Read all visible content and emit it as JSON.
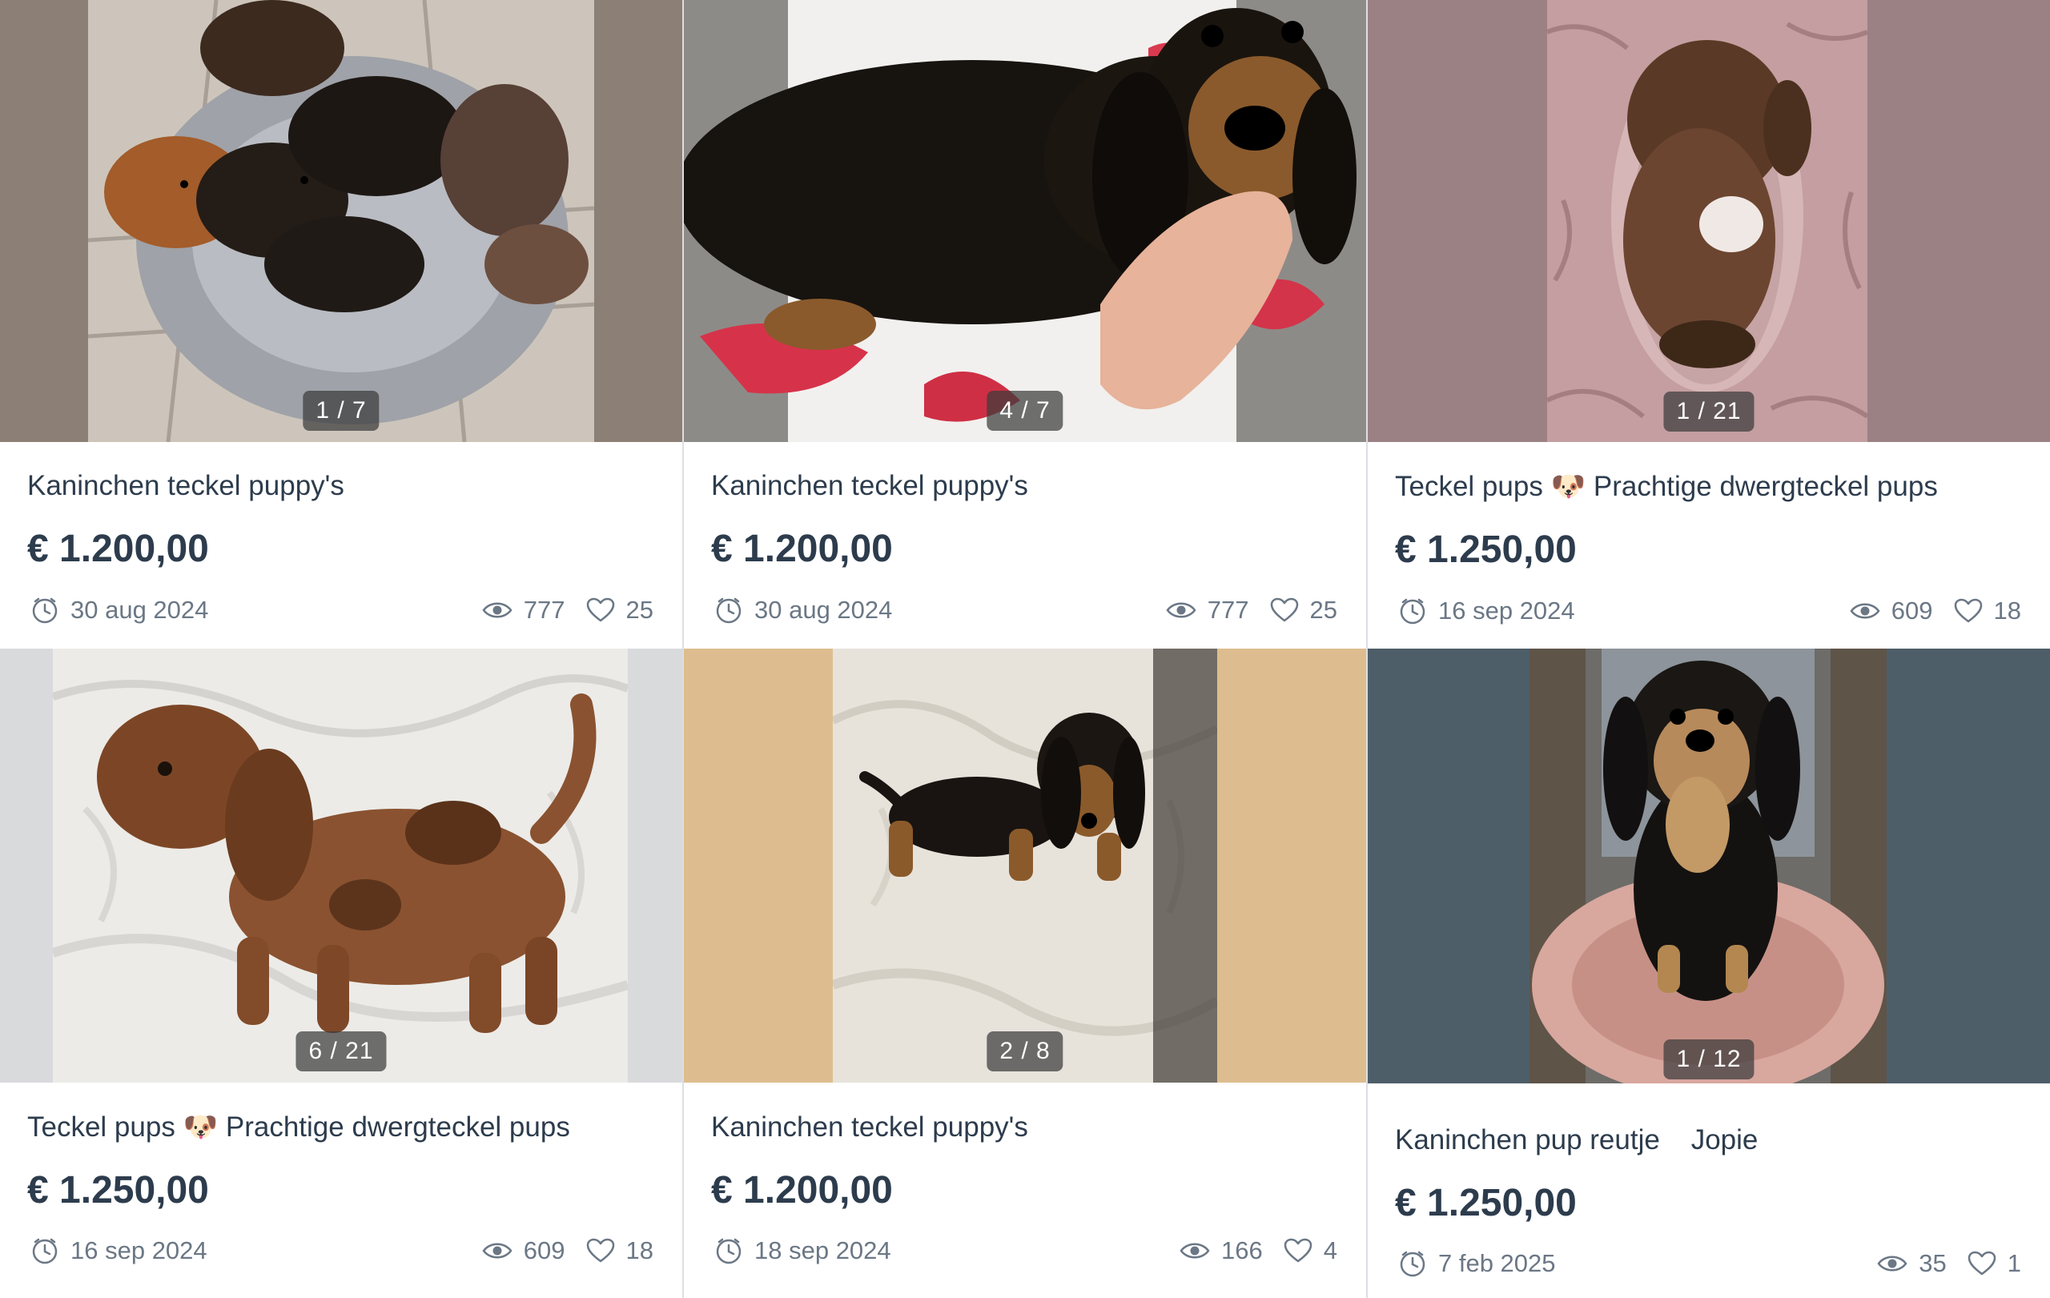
{
  "listings": [
    {
      "title": "Kaninchen teckel puppy's",
      "price": "€ 1.200,00",
      "date": "30 aug 2024",
      "views": "777",
      "likes": "25",
      "counter": "1 / 7",
      "bg_color": "#8b7f76"
    },
    {
      "title": "Kaninchen teckel puppy's",
      "price": "€ 1.200,00",
      "date": "30 aug 2024",
      "views": "777",
      "likes": "25",
      "counter": "4 / 7",
      "bg_color": "#9a9a96"
    },
    {
      "title": "Teckel pups 🐶 Prachtige dwergteckel pups",
      "price": "€ 1.250,00",
      "date": "16 sep 2024",
      "views": "609",
      "likes": "18",
      "counter": "1 / 21",
      "bg_color": "#9b8183"
    },
    {
      "title": "Teckel pups 🐶 Prachtige dwergteckel pups",
      "price": "€ 1.250,00",
      "date": "16 sep 2024",
      "views": "609",
      "likes": "18",
      "counter": "6 / 21",
      "bg_color": "#d9dadc"
    },
    {
      "title": "Kaninchen teckel puppy's",
      "price": "€ 1.200,00",
      "date": "18 sep 2024",
      "views": "166",
      "likes": "4",
      "counter": "2 / 8",
      "bg_color": "#ddbd8f"
    },
    {
      "title": "Kaninchen pup reutje    Jopie",
      "price": "€ 1.250,00",
      "date": "7 feb 2025",
      "views": "35",
      "likes": "1",
      "counter": "1 / 12",
      "bg_color": "#4e5e69"
    }
  ],
  "icons": {
    "date": "clock-icon",
    "views": "eye-icon",
    "likes": "heart-icon"
  }
}
